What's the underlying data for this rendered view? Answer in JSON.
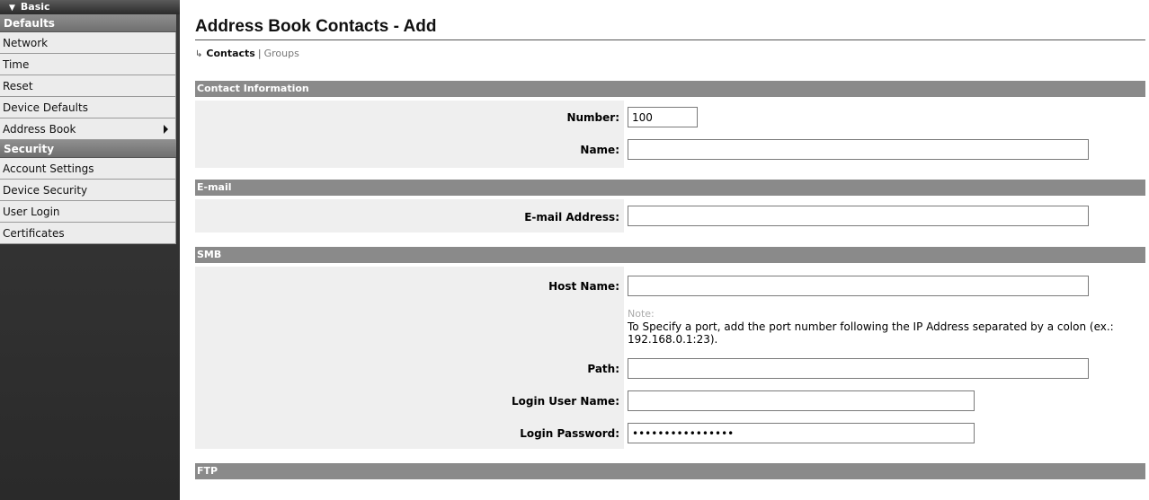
{
  "sidebar": {
    "top_label": "Basic",
    "sections": [
      {
        "title": "Defaults",
        "items": [
          "Network",
          "Time",
          "Reset",
          "Device Defaults",
          "Address Book"
        ]
      },
      {
        "title": "Security",
        "items": [
          "Account Settings",
          "Device Security",
          "User Login",
          "Certificates"
        ]
      }
    ]
  },
  "main": {
    "title": "Address Book Contacts - Add",
    "subnav": {
      "active": "Contacts",
      "separator": "|",
      "other": "Groups"
    },
    "contact": {
      "header": "Contact Information",
      "number_label": "Number:",
      "number_value": "100",
      "name_label": "Name:",
      "name_value": ""
    },
    "email": {
      "header": "E-mail",
      "address_label": "E-mail Address:",
      "address_value": ""
    },
    "smb": {
      "header": "SMB",
      "host_label": "Host Name:",
      "host_value": "",
      "note_label": "Note:",
      "note_text": "To Specify a port, add the port number following the IP Address separated by a colon (ex.: 192.168.0.1:23).",
      "path_label": "Path:",
      "path_value": "",
      "user_label": "Login User Name:",
      "user_value": "",
      "password_label": "Login Password:",
      "password_value": "••••••••••••••••"
    },
    "ftp": {
      "header": "FTP"
    }
  }
}
